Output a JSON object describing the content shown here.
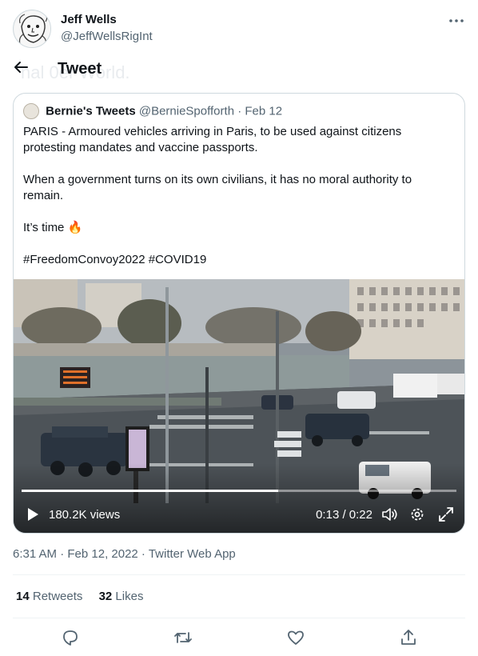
{
  "author": {
    "name": "Jeff Wells",
    "handle": "@JeffWellsRigInt",
    "more_icon": "more-horizontal-icon"
  },
  "header": {
    "back_icon": "arrow-left-icon",
    "title": "Tweet"
  },
  "quoted_tweet": {
    "name": "Bernie's Tweets",
    "handle": "@BernieSpofforth",
    "separator": "·",
    "date": "Feb 12",
    "paragraphs": [
      "PARIS - Armoured vehicles arriving in Paris, to be used against citizens protesting mandates and vaccine passports.",
      "When a government turns on its own civilians, it has no moral authority to remain.",
      "It’s time 🔥",
      "#FreedomConvoy2022 #COVID19"
    ],
    "video": {
      "views": "180.2K views",
      "time": "0:13 / 0:22",
      "progress": 0.59,
      "icons": [
        "play-icon",
        "volume-icon",
        "settings-icon",
        "fullscreen-icon"
      ]
    }
  },
  "meta": {
    "timestamp": "6:31 AM · Feb 12, 2022 · Twitter Web App"
  },
  "stats": {
    "retweets_count": "14",
    "retweets_label": "Retweets",
    "likes_count": "32",
    "likes_label": "Likes"
  },
  "actions": [
    "reply-icon",
    "retweet-icon",
    "like-icon",
    "share-icon"
  ],
  "colors": {
    "text": "#0f1419",
    "secondary": "#536471",
    "border": "#cfd9de"
  }
}
